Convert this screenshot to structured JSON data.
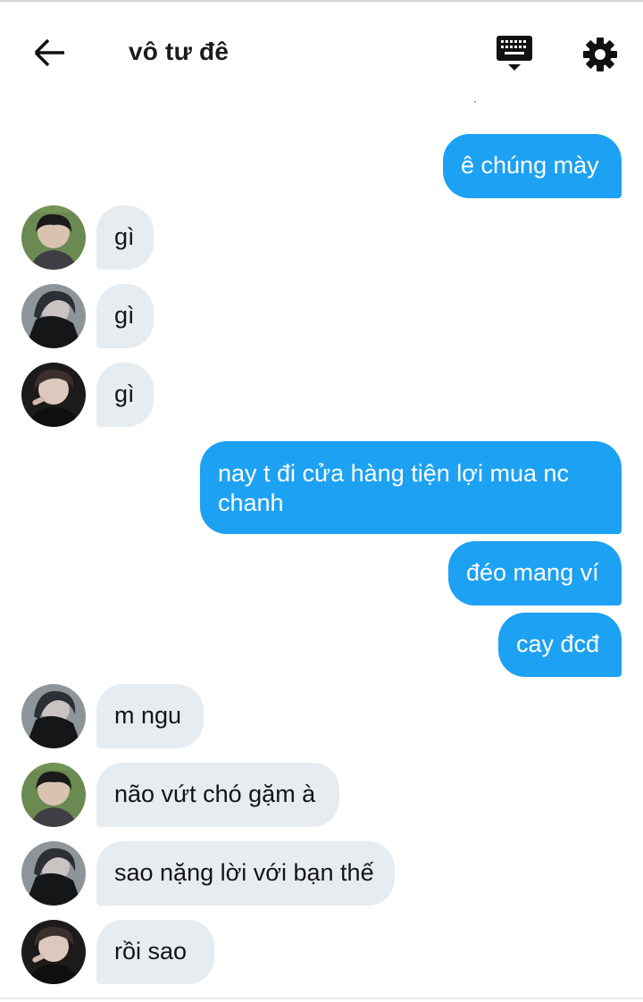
{
  "header": {
    "title": "vô tư đê",
    "back_icon": "arrow-left-icon",
    "keyboard_icon": "keyboard-icon",
    "settings_icon": "gear-icon"
  },
  "messages": [
    {
      "direction": "out",
      "text": "ê chúng mày"
    },
    {
      "direction": "in",
      "sender_avatar": "avatar-a",
      "text": "gì"
    },
    {
      "direction": "in",
      "sender_avatar": "avatar-b",
      "text": "gì"
    },
    {
      "direction": "in",
      "sender_avatar": "avatar-c",
      "text": "gì"
    },
    {
      "direction": "out",
      "text": "nay t đi cửa hàng tiện lợi mua nc chanh"
    },
    {
      "direction": "out",
      "text": "đéo mang ví"
    },
    {
      "direction": "out",
      "text": "cay đcđ"
    },
    {
      "direction": "in",
      "sender_avatar": "avatar-b",
      "text": "m ngu"
    },
    {
      "direction": "in",
      "sender_avatar": "avatar-a",
      "text": "não vứt chó gặm à"
    },
    {
      "direction": "in",
      "sender_avatar": "avatar-b",
      "text": "sao nặng lời với bạn thế"
    },
    {
      "direction": "in",
      "sender_avatar": "avatar-c",
      "text": "rồi sao"
    }
  ],
  "colors": {
    "outgoing_bubble": "#1da1f2",
    "incoming_bubble": "#e6ecf0",
    "text_dark": "#141414"
  }
}
